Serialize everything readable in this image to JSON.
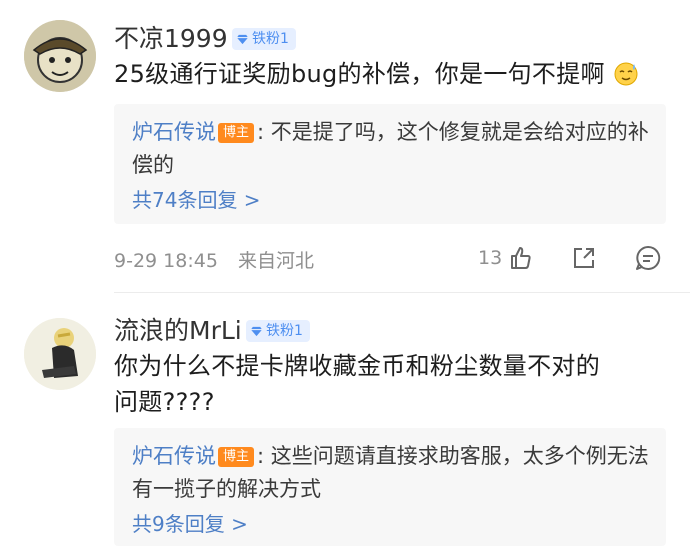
{
  "comments": [
    {
      "username": "不凉1999",
      "fan_badge": "铁粉1",
      "text": "25级通行证奖励bug的补偿，你是一句不提啊",
      "emoji": "sweat-smile-emoji",
      "reply": {
        "author": "炉石传说",
        "host_badge": "博主",
        "text": ": 不是提了吗，这个修复就是会给对应的补偿的",
        "view_more": "共74条回复 >"
      },
      "time": "9-29 18:45",
      "location": "来自河北",
      "like_count": "13"
    },
    {
      "username": "流浪的MrLi",
      "fan_badge": "铁粉1",
      "text": "你为什么不提卡牌收藏金币和粉尘数量不对的问题????",
      "reply": {
        "author": "炉石传说",
        "host_badge": "博主",
        "text": ": 这些问题请直接求助客服，太多个例无法有一揽子的解决方式",
        "view_more": "共9条回复 >"
      }
    }
  ],
  "colors": {
    "link_blue": "#4e7fc6",
    "badge_blue_bg": "#e6efff",
    "host_badge_orange": "#ff8a1e",
    "reply_bg": "#f7f7f7"
  }
}
